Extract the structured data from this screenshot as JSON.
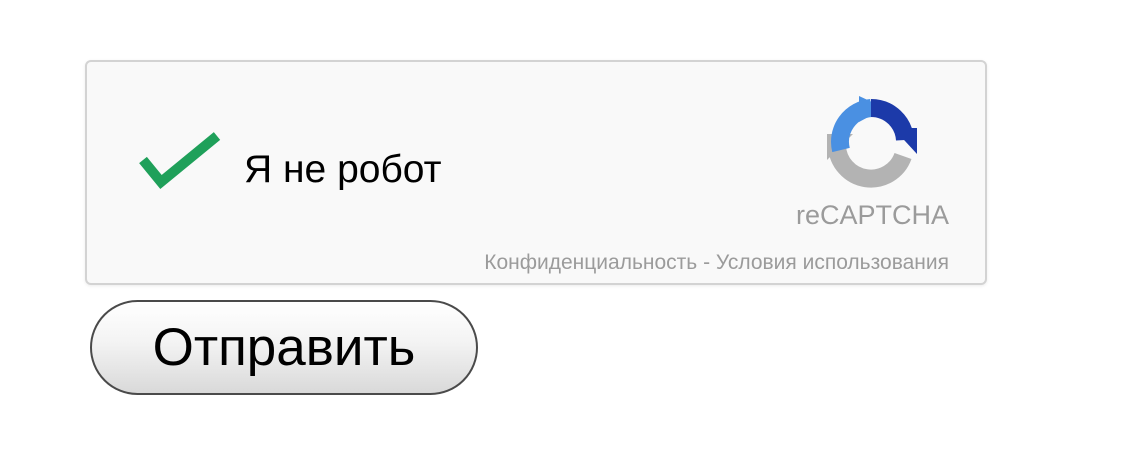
{
  "captcha": {
    "checked": true,
    "check_icon": "checkmark-icon",
    "check_color": "#1fa05a",
    "label": "Я не робот",
    "logo_icon": "recaptcha-logo-icon",
    "logo_colors": {
      "blue_dark": "#1c3aa9",
      "blue_light": "#4a90e2",
      "gray": "#b3b3b3"
    },
    "brand": "reCAPTCHA",
    "privacy_link": "Конфиденциальность",
    "separator": " - ",
    "terms_link": "Условия использования"
  },
  "form": {
    "submit_label": "Отправить"
  }
}
